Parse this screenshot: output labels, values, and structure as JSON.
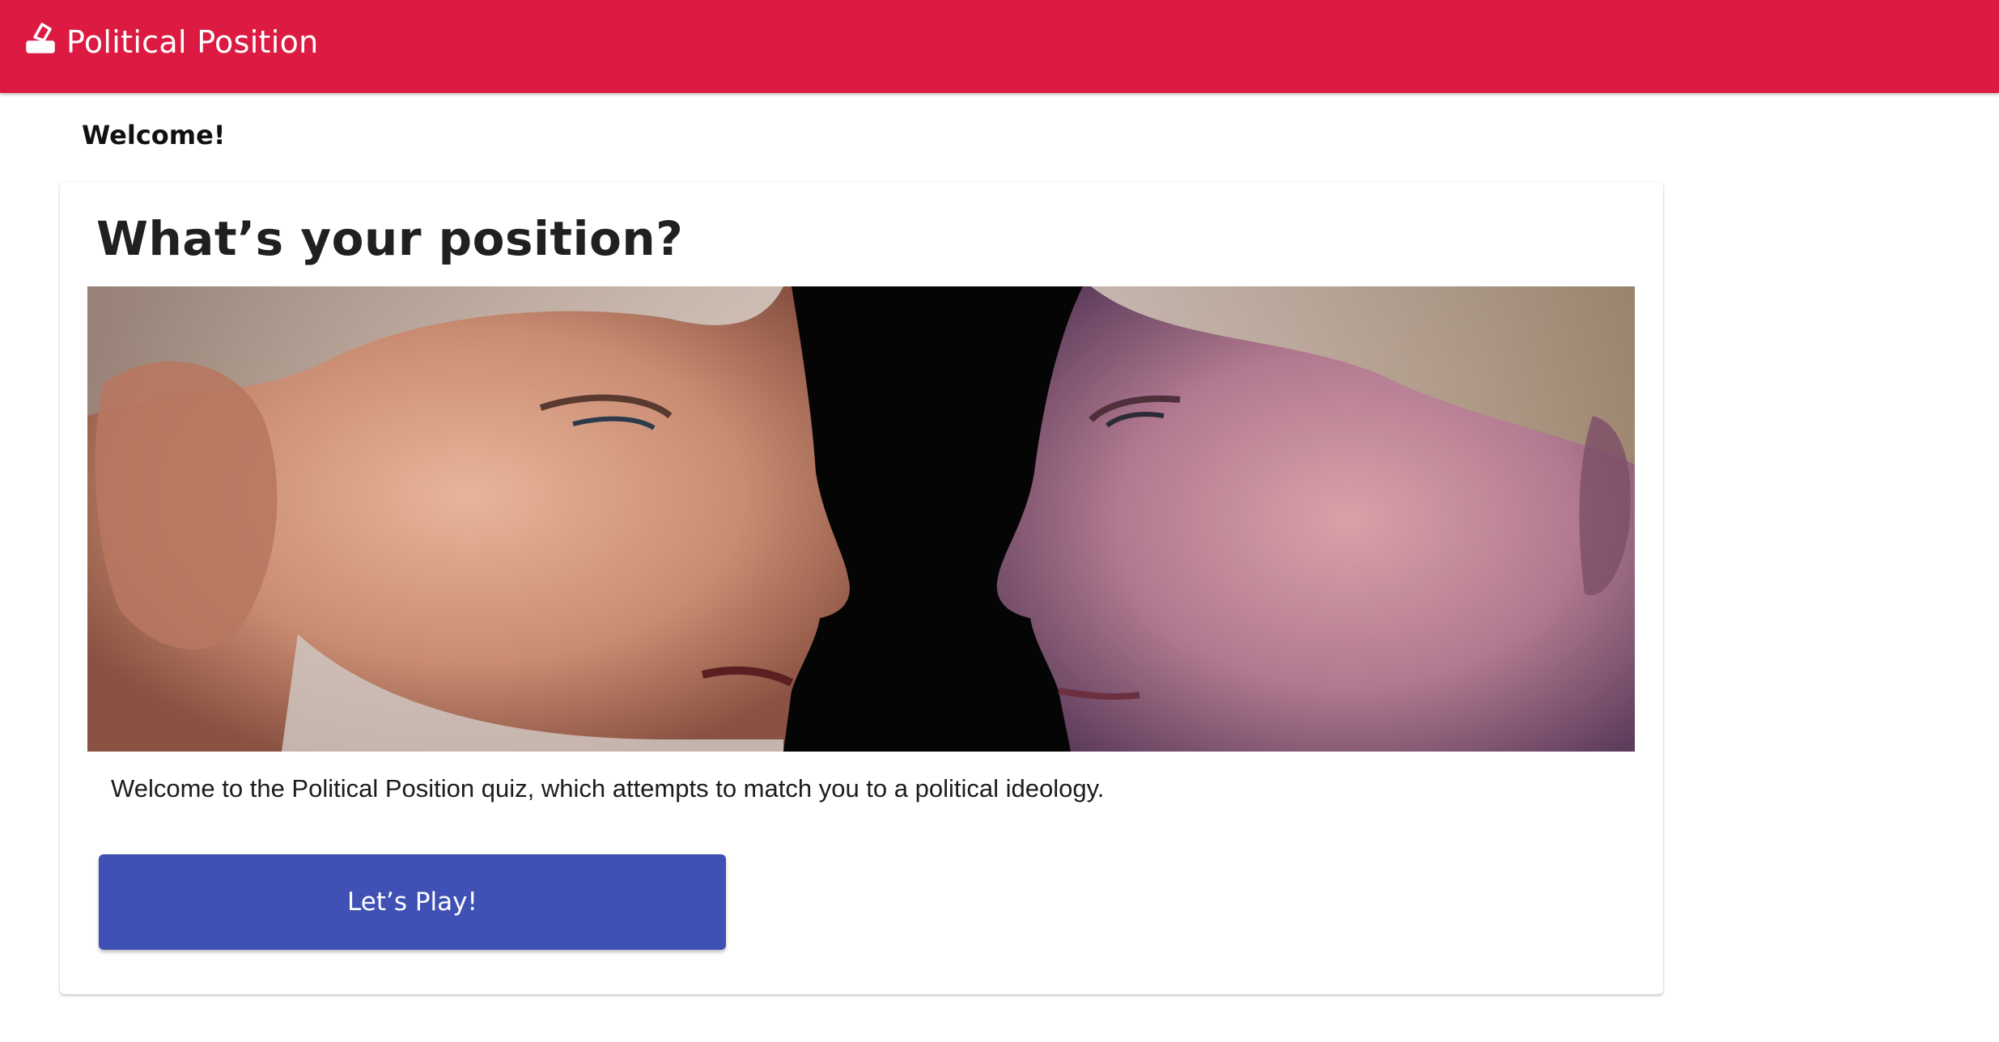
{
  "appbar": {
    "title": "Political Position",
    "logo_icon": "ballot-box-icon",
    "background_color": "#dc1a42"
  },
  "page": {
    "heading": "Welcome!"
  },
  "card": {
    "title": "What’s your position?",
    "hero_image_alt": "Two politicians facing each other",
    "intro_text": "Welcome to the Political Position quiz, which attempts to match you to a political ideology.",
    "play_button_label": "Let’s Play!",
    "play_button_color": "#3f51b5"
  }
}
